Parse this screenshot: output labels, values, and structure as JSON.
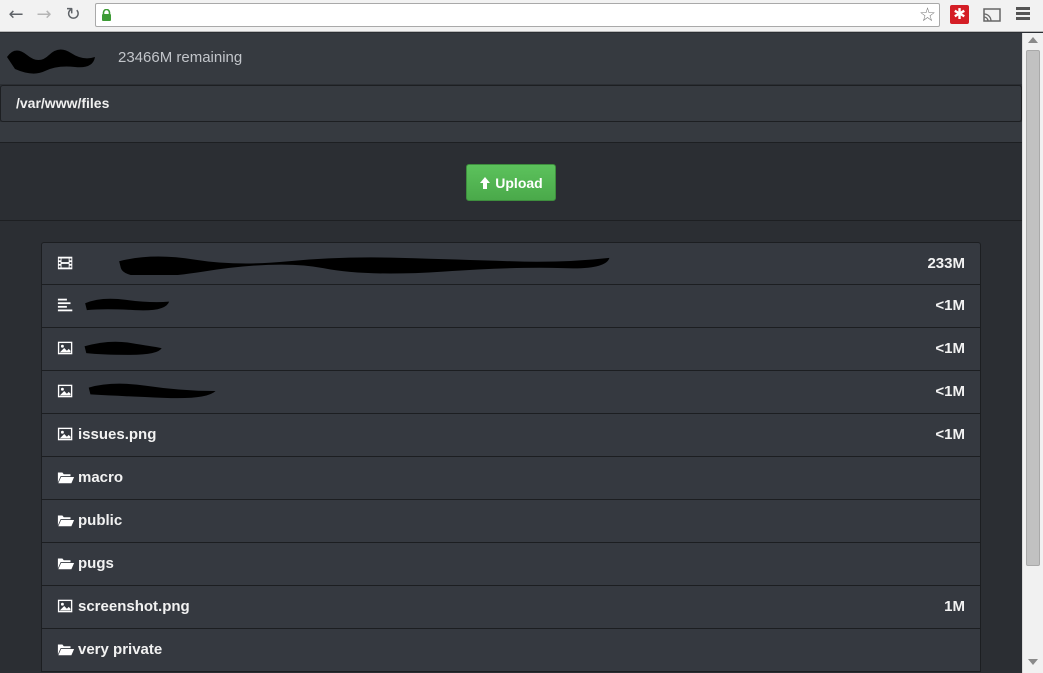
{
  "browser": {
    "url": "",
    "icons": {
      "back": "back-arrow-icon",
      "forward": "forward-arrow-icon",
      "reload": "reload-icon",
      "secure": "lock-icon",
      "bookmark": "star-icon",
      "extension": "lastpass-icon",
      "cast": "cast-icon",
      "menu": "hamburger-menu-icon"
    }
  },
  "header": {
    "remaining": "23466M remaining"
  },
  "path": "/var/www/files",
  "upload": {
    "label": "Upload",
    "icon": "arrow-up-icon",
    "color": "#4cae4c"
  },
  "files": [
    {
      "icon": "film-icon",
      "name": "",
      "size": "233M",
      "redacted": true
    },
    {
      "icon": "text-file-icon",
      "name": "",
      "size": "<1M",
      "redacted": true
    },
    {
      "icon": "image-icon",
      "name": "",
      "size": "<1M",
      "redacted": true
    },
    {
      "icon": "image-icon",
      "name": "",
      "size": "<1M",
      "redacted": true
    },
    {
      "icon": "image-icon",
      "name": "issues.png",
      "size": "<1M",
      "redacted": false
    },
    {
      "icon": "folder-open-icon",
      "name": "macro",
      "size": "",
      "redacted": false
    },
    {
      "icon": "folder-open-icon",
      "name": "public",
      "size": "",
      "redacted": false
    },
    {
      "icon": "folder-open-icon",
      "name": "pugs",
      "size": "",
      "redacted": false
    },
    {
      "icon": "image-icon",
      "name": "screenshot.png",
      "size": "1M",
      "redacted": false
    },
    {
      "icon": "folder-open-icon",
      "name": "very private",
      "size": "",
      "redacted": false
    }
  ]
}
